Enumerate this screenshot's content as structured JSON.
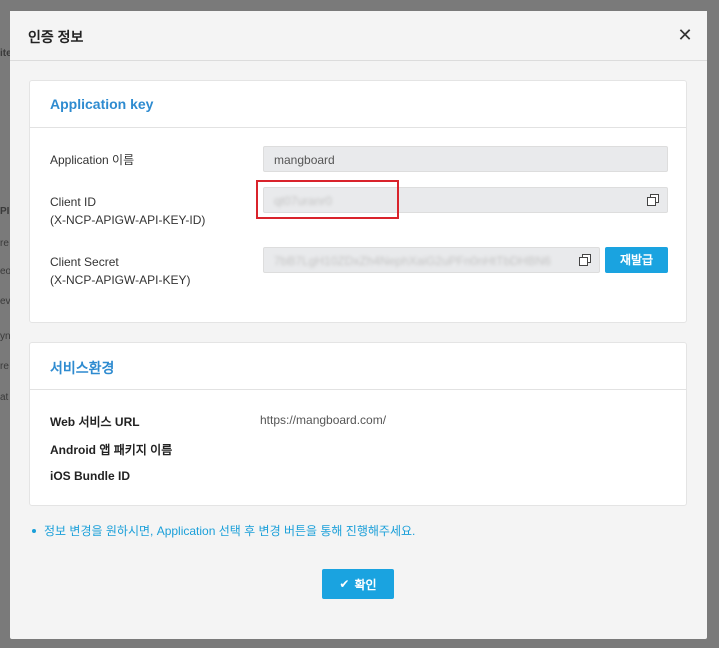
{
  "dialog": {
    "title": "인증 정보",
    "close_icon": "close-icon"
  },
  "application_key": {
    "section_title": "Application key",
    "app_name_label": "Application 이름",
    "app_name_value": "mangboard",
    "client_id_label_1": "Client ID",
    "client_id_label_2": "(X-NCP-APIGW-API-KEY-ID)",
    "client_id_value": "qt07uranr0",
    "client_secret_label_1": "Client Secret",
    "client_secret_label_2": "(X-NCP-APIGW-API-KEY)",
    "client_secret_value": "7bB7LgH10ZDxZh4NephXaiG2uPFn0nHtTbDHBN6",
    "reissue_label": "재발급"
  },
  "service_env": {
    "section_title": "서비스환경",
    "web_url_label": "Web 서비스 URL",
    "web_url_value": "https://mangboard.com/",
    "android_label": "Android 앱 패키지 이름",
    "ios_label": "iOS Bundle ID"
  },
  "note": "정보 변경을 원하시면, Application 선택 후 변경 버튼을 통해 진행해주세요.",
  "confirm_label": "확인",
  "colors": {
    "accent": "#1aa3e0",
    "section_title": "#2e8bd0",
    "highlight": "#d9232b"
  }
}
